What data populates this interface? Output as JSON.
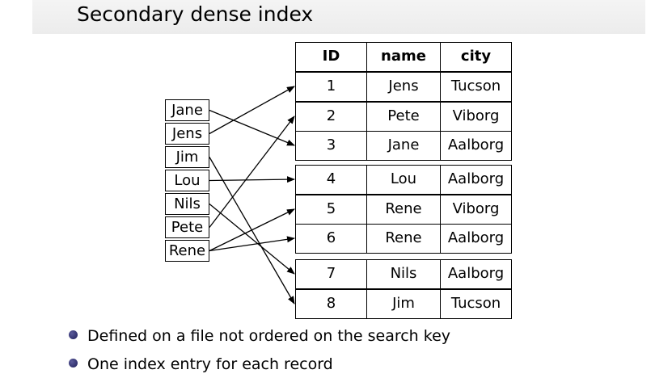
{
  "title": "Secondary dense index",
  "index_entries": [
    "Jane",
    "Jens",
    "Jim",
    "Lou",
    "Nils",
    "Pete",
    "Rene"
  ],
  "table": {
    "headers": [
      "ID",
      "name",
      "city"
    ],
    "blocks": [
      [
        [
          "1",
          "Jens",
          "Tucson"
        ],
        [
          "2",
          "Pete",
          "Viborg"
        ],
        [
          "3",
          "Jane",
          "Aalborg"
        ]
      ],
      [
        [
          "4",
          "Lou",
          "Aalborg"
        ],
        [
          "5",
          "Rene",
          "Viborg"
        ],
        [
          "6",
          "Rene",
          "Aalborg"
        ]
      ],
      [
        [
          "7",
          "Nils",
          "Aalborg"
        ],
        [
          "8",
          "Jim",
          "Tucson"
        ]
      ]
    ]
  },
  "pointers": [
    {
      "from": "Jane",
      "to": "3"
    },
    {
      "from": "Jens",
      "to": "1"
    },
    {
      "from": "Jim",
      "to": "8"
    },
    {
      "from": "Lou",
      "to": "4"
    },
    {
      "from": "Nils",
      "to": "7"
    },
    {
      "from": "Pete",
      "to": "2"
    },
    {
      "from": "Rene",
      "to": "5"
    },
    {
      "from": "Rene",
      "to": "6"
    }
  ],
  "bullets": [
    "Defined on a file not ordered on the search key",
    "One index entry for each record"
  ]
}
